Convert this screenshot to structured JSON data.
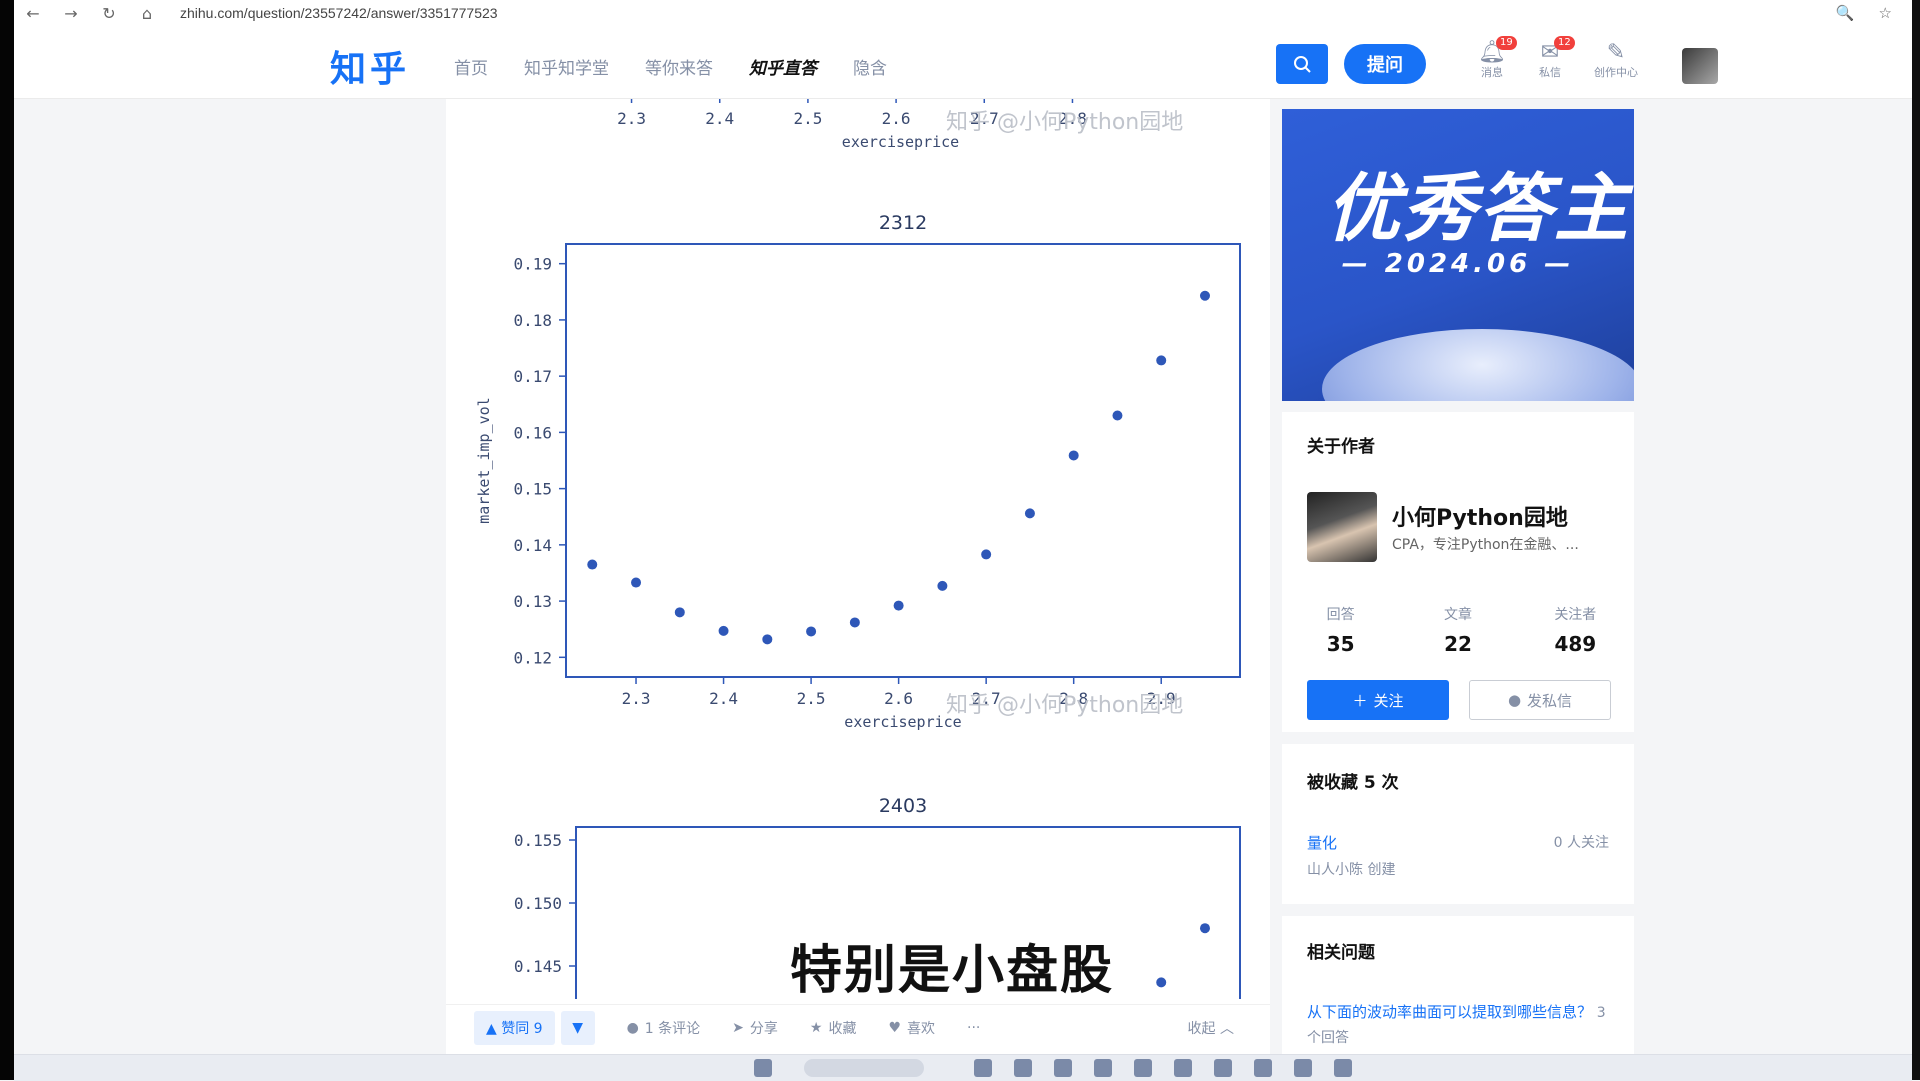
{
  "browser": {
    "url": "zhihu.com/question/23557242/answer/3351777523",
    "back": "←",
    "forward": "→",
    "reload": "↻",
    "home": "⌂",
    "zoom_icon": "🔍",
    "star_icon": "☆"
  },
  "header": {
    "logo": "知乎",
    "nav": [
      "首页",
      "知乎知学堂",
      "等你来答",
      "知乎直答",
      "隐含"
    ],
    "ask_label": "提问",
    "icons": [
      {
        "name": "notification-icon",
        "label": "消息",
        "badge": "19"
      },
      {
        "name": "message-icon",
        "label": "私信",
        "badge": "12"
      },
      {
        "name": "creator-icon",
        "label": "创作中心",
        "badge": ""
      }
    ]
  },
  "watermark": "知乎 @小何Python园地",
  "chart_data": [
    {
      "type": "scatter",
      "title": "",
      "xlabel": "exerciseprice",
      "ylabel": "",
      "xlim": [
        2.22,
        2.99
      ],
      "xticks": [
        "2.3",
        "2.4",
        "2.5",
        "2.6",
        "2.7",
        "2.8"
      ],
      "note_visible": "partial chart cut at top"
    },
    {
      "type": "scatter",
      "title": "2312",
      "xlabel": "exerciseprice",
      "ylabel": "market_imp_vol",
      "xlim": [
        2.22,
        2.99
      ],
      "ylim": [
        0.1165,
        0.1935
      ],
      "xticks": [
        "2.3",
        "2.4",
        "2.5",
        "2.6",
        "2.7",
        "2.8",
        "2.9"
      ],
      "yticks": [
        "0.12",
        "0.13",
        "0.14",
        "0.15",
        "0.16",
        "0.17",
        "0.18",
        "0.19"
      ],
      "x": [
        2.25,
        2.3,
        2.35,
        2.4,
        2.45,
        2.5,
        2.55,
        2.6,
        2.65,
        2.7,
        2.75,
        2.8,
        2.85,
        2.9,
        2.95
      ],
      "y": [
        0.1365,
        0.1333,
        0.128,
        0.1247,
        0.1232,
        0.1246,
        0.1262,
        0.1292,
        0.1327,
        0.1383,
        0.1456,
        0.1559,
        0.163,
        0.1728,
        0.1843
      ]
    },
    {
      "type": "scatter",
      "title": "2403",
      "xlabel": "",
      "ylabel": "",
      "ylim_visible": [
        0.143,
        0.156
      ],
      "yticks": [
        "0.155",
        "0.150",
        "0.145"
      ],
      "x": [
        2.9,
        2.95
      ],
      "y": [
        0.1437,
        0.148
      ]
    }
  ],
  "actions": {
    "vote_up": "▲ 赞同 9",
    "vote_down": "▼",
    "comment": "1 条评论",
    "share": "分享",
    "favorite": "收藏",
    "like": "喜欢",
    "more": "···",
    "collapse": "收起 ︿"
  },
  "subtitle": "特别是小盘股",
  "banner": {
    "title": "优秀答主",
    "date": "— 2024.06 —"
  },
  "author": {
    "section_title": "关于作者",
    "name": "小何Python园地",
    "bio": "CPA，专注Python在金融、...",
    "stats": [
      {
        "label": "回答",
        "value": "35"
      },
      {
        "label": "文章",
        "value": "22"
      },
      {
        "label": "关注者",
        "value": "489"
      }
    ],
    "follow_label": "关注",
    "message_label": "发私信"
  },
  "collections": {
    "title": "被收藏 5 次",
    "item_name": "量化",
    "item_followers": "0 人关注",
    "item_creator": "山人小陈 创建"
  },
  "related": {
    "title": "相关问题",
    "question": "从下面的波动率曲面可以提取到哪些信息？",
    "answers": "3 个回答"
  }
}
